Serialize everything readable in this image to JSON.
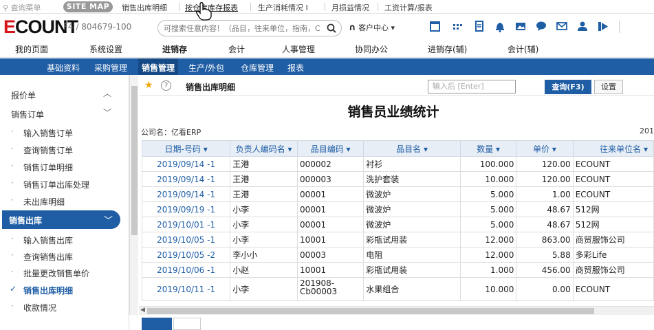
{
  "quickbar": {
    "search_menu": "查询菜单",
    "site_map": "SITE MAP",
    "links": [
      "销售出库明细",
      "按仓库库存报表",
      "生产消耗情况 I",
      "月损益情况",
      "工资计算/报表"
    ]
  },
  "header": {
    "logo_e": "E",
    "logo_rest": "COUNT",
    "company_code": "F4 / 804679-100",
    "search_placeholder": "可搜索任意内容！（品目，往来单位，指南，C",
    "customer_center": "客户中心 ▾"
  },
  "main_menu": [
    "我的页面",
    "系统设置",
    "进销存",
    "会计",
    "人事管理",
    "协同办公",
    "进销存(辅)",
    "会计(辅)"
  ],
  "sub_menu": [
    "基础资料",
    "采购管理",
    "销售管理",
    "生产/外包",
    "仓库管理",
    "报表"
  ],
  "sidebar": {
    "group1": "报价单",
    "group2": "销售订单",
    "items_order": [
      "输入销售订单",
      "查询销售订单",
      "销售订单明细",
      "销售订单出库处理",
      "未出库明细"
    ],
    "group_active": "销售出库",
    "items_out": [
      "输入销售出库",
      "查询销售出库",
      "批量更改销售单价",
      "销售出库明细",
      "收款情况"
    ],
    "selected_item": "销售出库明细",
    "check": "✓",
    "dot": "·",
    "chevron_up": "︿",
    "chevron_down": "﹀"
  },
  "toolbar": {
    "star": "★",
    "help": "?",
    "title": "销售出库明细",
    "input_placeholder": "输入后 [Enter]",
    "query_button": "查询(F3)",
    "settings_button": "设置"
  },
  "report": {
    "title": "销售员业绩统计",
    "company": "公司名：亿看ERP",
    "date_fragment": "201"
  },
  "table": {
    "headers": [
      "日期-号码 ▾",
      "负责人编码名 ▾",
      "品目编码 ▾",
      "品目名 ▾",
      "数量 ▾",
      "单价 ▾",
      "往来单位名 ▾"
    ],
    "rows": [
      [
        "2019/09/14 -1",
        "王港",
        "000002",
        "衬衫",
        "100.000",
        "120.00",
        "ECOUNT"
      ],
      [
        "2019/09/14 -1",
        "王港",
        "000003",
        "洗护套装",
        "10.000",
        "120.00",
        "ECOUNT"
      ],
      [
        "2019/09/14 -1",
        "王港",
        "00001",
        "微波炉",
        "5.000",
        "1.00",
        "ECOUNT"
      ],
      [
        "2019/09/19 -1",
        "小李",
        "00001",
        "微波炉",
        "5.000",
        "48.67",
        "512网"
      ],
      [
        "2019/10/01 -1",
        "小李",
        "00001",
        "微波炉",
        "5.000",
        "48.67",
        "512网"
      ],
      [
        "2019/10/05 -1",
        "小李",
        "10001",
        "彩瓶试用装",
        "12.000",
        "863.00",
        "商贸服饰公司"
      ],
      [
        "2019/10/05 -2",
        "李小小",
        "00003",
        "电阻",
        "12.000",
        "5.88",
        "多彩Life"
      ],
      [
        "2019/10/06 -1",
        "小赵",
        "10001",
        "彩瓶试用装",
        "1.000",
        "456.00",
        "商贸服饰公司"
      ],
      [
        "2019/10/11 -1",
        "小李",
        "201908-Cb00003",
        "水果组合",
        "10.000",
        "0.00",
        "ECOUNT"
      ]
    ]
  },
  "colors": {
    "brand_blue": "#1f5ea5",
    "logo_red": "#d6151b"
  }
}
